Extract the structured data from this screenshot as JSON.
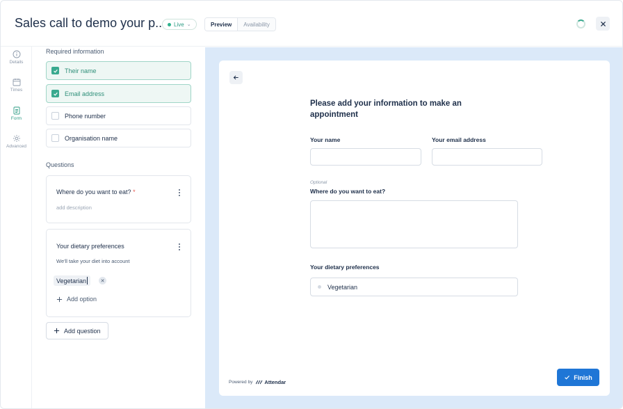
{
  "header": {
    "title": "Sales call to demo your p...",
    "status": "Live",
    "tabs": [
      "Preview",
      "Availability"
    ],
    "active_tab": "Preview"
  },
  "nav": {
    "items": [
      {
        "label": "Details",
        "icon": "info-icon"
      },
      {
        "label": "Times",
        "icon": "calendar-icon"
      },
      {
        "label": "Form",
        "icon": "form-icon",
        "active": true
      },
      {
        "label": "Advanced",
        "icon": "gear-icon"
      }
    ]
  },
  "form": {
    "required_label": "Required information",
    "required_fields": [
      {
        "label": "Their name",
        "checked": true
      },
      {
        "label": "Email address",
        "checked": true
      },
      {
        "label": "Phone number",
        "checked": false
      },
      {
        "label": "Organisation name",
        "checked": false
      }
    ],
    "questions_label": "Questions",
    "questions": [
      {
        "title": "Where do you want to eat?",
        "required_mark": "*",
        "description": "add description"
      },
      {
        "title": "Your dietary preferences",
        "description": "We'll take your diet into account",
        "options": [
          "Vegetarian"
        ],
        "add_option": "Add option"
      }
    ],
    "add_question": "Add question"
  },
  "preview": {
    "heading": "Please add your information to make an appointment",
    "name_label": "Your name",
    "email_label": "Your email address",
    "optional_tag": "Optional",
    "eat_label": "Where do you want to eat?",
    "diet_label": "Your dietary preferences",
    "diet_option": "Vegetarian",
    "powered_by": "Powered by",
    "brand": "Attendar",
    "finish": "Finish"
  },
  "colors": {
    "accent": "#3aa98f",
    "primary_button": "#1f76d6",
    "preview_background": "#dbe9f9"
  }
}
